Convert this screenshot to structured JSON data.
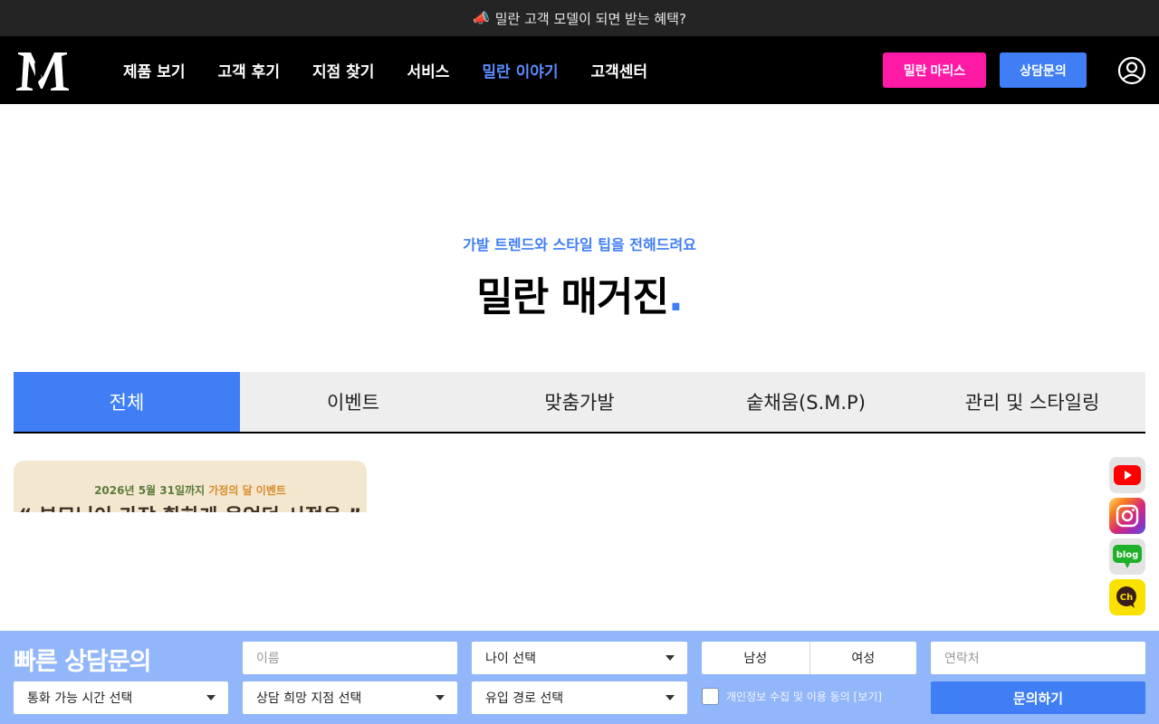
{
  "announcement": {
    "icon": "megaphone-icon",
    "text": "밀란 고객 모델이 되면 받는 혜택?"
  },
  "header": {
    "logo_text": "M",
    "nav": [
      "제품 보기",
      "고객 후기",
      "지점 찾기",
      "서비스",
      "밀란 이야기",
      "고객센터"
    ],
    "active_nav": "밀란 이야기",
    "mars_label": "밀란 마리스",
    "consult_label": "상담문의",
    "user_icon": "user-icon"
  },
  "hero": {
    "subtitle": "가발 트렌드와 스타일 팁을 전해드려요",
    "title": "밀란 매거진",
    "title_dot": "."
  },
  "tabs": [
    "전체",
    "이벤트",
    "맞춤가발",
    "숱채움(S.M.P)",
    "관리 및 스타일링"
  ],
  "active_tab": "전체",
  "card": {
    "caption_pre": "2026년 5월 31일까지 ",
    "caption_highlight": "가정의 달 이벤트",
    "headline": "“ 부모님이 가장 환하게 웃었던 시절을 ”"
  },
  "social": [
    "youtube-icon",
    "instagram-icon",
    "blog-icon",
    "kakao-channel-icon"
  ],
  "social_labels": {
    "blog": "blog",
    "channel": "Ch"
  },
  "quick_consult": {
    "title": "빠른 상담문의",
    "name_placeholder": "이름",
    "age_select": "나이 선택",
    "gender": [
      "남성",
      "여성"
    ],
    "phone_placeholder": "연락처",
    "call_time_select": "통화 가능 시간 선택",
    "branch_select": "상담 희망 지점 선택",
    "source_select": "유입 경로 선택",
    "consent_text": "개인정보 수집 및 이용 동의 [보기]",
    "submit_label": "문의하기"
  },
  "colors": {
    "accent": "#3f7ef5",
    "pink": "#ff1aa6",
    "header_bg": "#000000",
    "bar_bg": "#92b6fa"
  }
}
